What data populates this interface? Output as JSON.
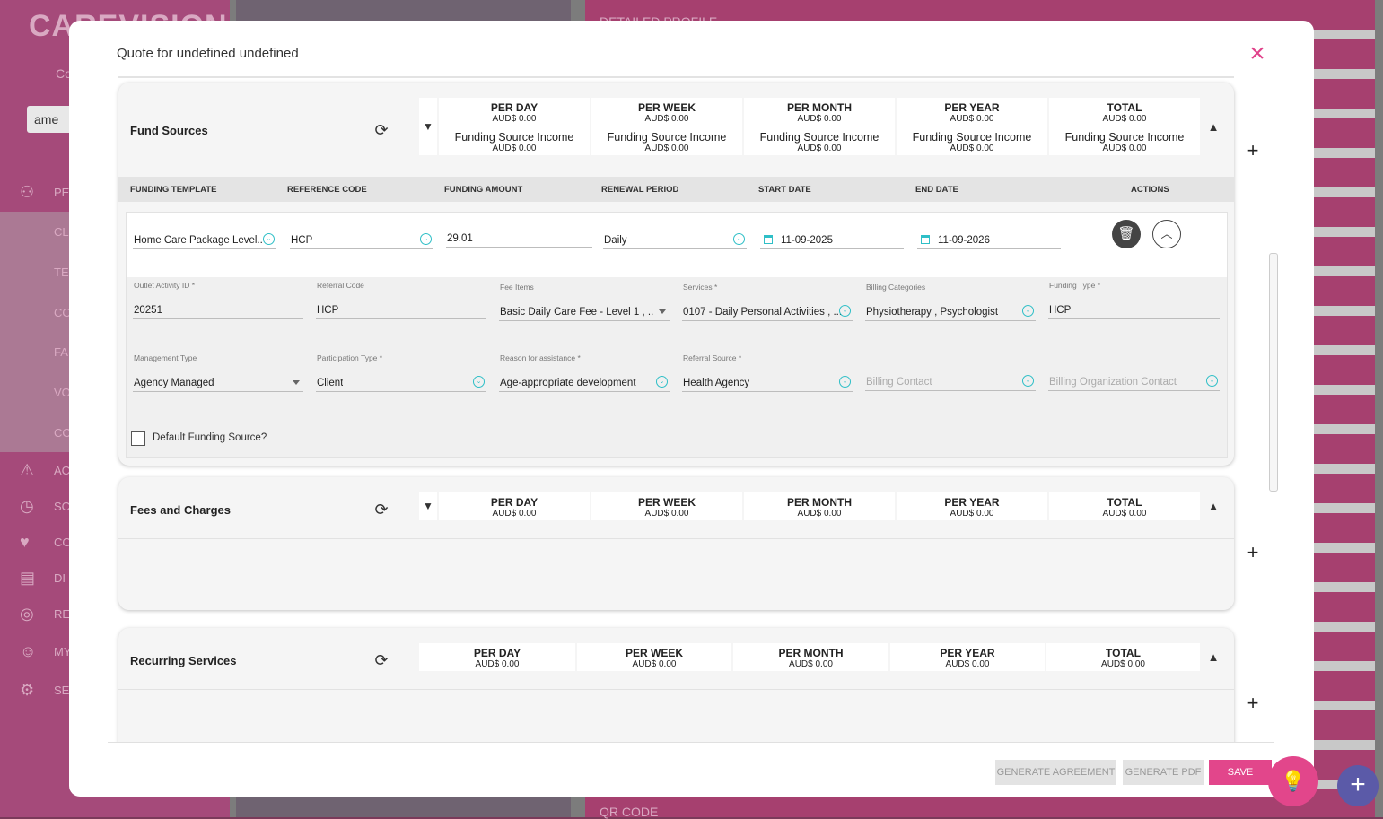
{
  "background": {
    "logo": "CAREVISION",
    "company_partial": "Co",
    "search_value": "ame",
    "nav_items": [
      "PE",
      "CL",
      "TE",
      "CO",
      "FA",
      "VO",
      "CO",
      "AC",
      "SC",
      "CO",
      "DI",
      "RE",
      "MY",
      "SE"
    ],
    "top_label": "DETAILED PROFILE",
    "bottom_label": "QR CODE",
    "fab_symbol": "+"
  },
  "modal": {
    "title": "Quote for undefined undefined",
    "close_symbol": "×"
  },
  "periods": [
    "PER DAY",
    "PER WEEK",
    "PER MONTH",
    "PER YEAR",
    "TOTAL"
  ],
  "fund_sources": {
    "title": "Fund Sources",
    "summary": [
      {
        "value": "AUD$ 0.00",
        "income_label": "Funding Source Income",
        "income_value": "AUD$ 0.00"
      },
      {
        "value": "AUD$ 0.00",
        "income_label": "Funding Source Income",
        "income_value": "AUD$ 0.00"
      },
      {
        "value": "AUD$ 0.00",
        "income_label": "Funding Source Income",
        "income_value": "AUD$ 0.00"
      },
      {
        "value": "AUD$ 0.00",
        "income_label": "Funding Source Income",
        "income_value": "AUD$ 0.00"
      },
      {
        "value": "AUD$ 0.00",
        "income_label": "Funding Source Income",
        "income_value": "AUD$ 0.00"
      }
    ],
    "columns": [
      "FUNDING TEMPLATE",
      "REFERENCE CODE",
      "FUNDING AMOUNT",
      "RENEWAL PERIOD",
      "START DATE",
      "END DATE",
      "ACTIONS"
    ],
    "row": {
      "funding_template": "Home Care Package Level...",
      "reference_code": "HCP",
      "funding_amount": "29.01",
      "renewal_period": "Daily",
      "start_date": "11-09-2025",
      "end_date": "11-09-2026",
      "details": {
        "outlet_activity_id": {
          "label": "Outlet Activity ID *",
          "value": "20251"
        },
        "referral_code": {
          "label": "Referral Code",
          "value": "HCP"
        },
        "fee_items": {
          "label": "Fee Items",
          "value": "Basic Daily Care Fee - Level 1 , ..."
        },
        "services": {
          "label": "Services *",
          "value": "0107 - Daily Personal Activities , ..."
        },
        "billing_categories": {
          "label": "Billing Categories",
          "value": "Physiotherapy , Psychologist"
        },
        "funding_type": {
          "label": "Funding Type *",
          "value": "HCP"
        },
        "management_type": {
          "label": "Management Type",
          "value": "Agency Managed"
        },
        "participation_type": {
          "label": "Participation Type *",
          "value": "Client"
        },
        "reason_for_assistance": {
          "label": "Reason for assistance *",
          "value": "Age-appropriate development"
        },
        "referral_source": {
          "label": "Referral Source *",
          "value": "Health Agency"
        },
        "billing_contact": {
          "placeholder": "Billing Contact"
        },
        "billing_org_contact": {
          "placeholder": "Billing Organization Contact"
        }
      },
      "default_label": "Default Funding Source?"
    }
  },
  "fees_and_charges": {
    "title": "Fees and Charges",
    "values": [
      "AUD$ 0.00",
      "AUD$ 0.00",
      "AUD$ 0.00",
      "AUD$ 0.00",
      "AUD$ 0.00"
    ]
  },
  "recurring_services": {
    "title": "Recurring Services",
    "values": [
      "AUD$ 0.00",
      "AUD$ 0.00",
      "AUD$ 0.00",
      "AUD$ 0.00",
      "AUD$ 0.00"
    ]
  },
  "footer": {
    "generate_agreement": "GENERATE AGREEMENT",
    "generate_pdf": "GENERATE PDF",
    "save": "SAVE"
  },
  "colors": {
    "accent": "#e2468b",
    "teal_icon": "#2fbfc7",
    "bg_sidebar": "#a54a7a"
  }
}
